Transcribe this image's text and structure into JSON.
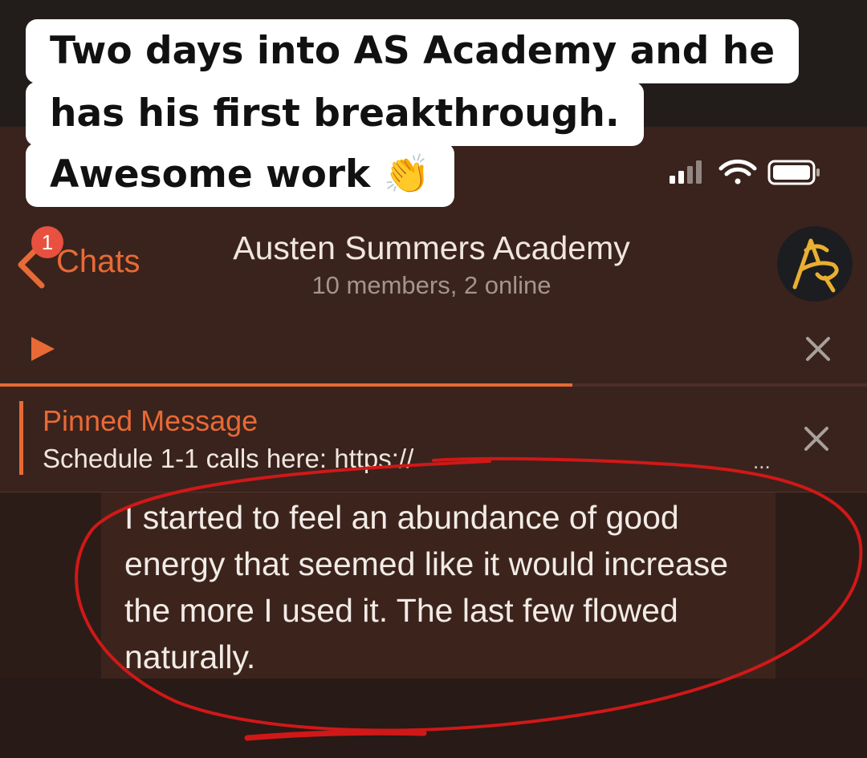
{
  "caption": {
    "lines": [
      "Two days into AS Academy and he",
      "has his first breakthrough.",
      "Awesome work 👏"
    ]
  },
  "status_bar": {
    "icons": [
      "signal-icon",
      "wifi-icon",
      "battery-icon"
    ]
  },
  "header": {
    "back_label": "Chats",
    "unread_badge": "1",
    "title": "Austen Summers Academy",
    "subtitle": "10 members, 2 online",
    "avatar_logo": "AS"
  },
  "audio_player": {
    "play_icon": "play-icon",
    "close_icon": "close-icon",
    "progress": 0.66
  },
  "pinned": {
    "title": "Pinned Message",
    "text": "Schedule 1-1 calls here: https://",
    "ellipsis": "...",
    "close_icon": "close-icon"
  },
  "message": {
    "text": "I started to feel an abundance of good energy that seemed like it would increase the more I used it. The last few flowed naturally."
  },
  "colors": {
    "accent": "#e86a35",
    "header_bg": "#3a231d",
    "annotation_red": "#d01818",
    "badge": "#e8513f"
  }
}
